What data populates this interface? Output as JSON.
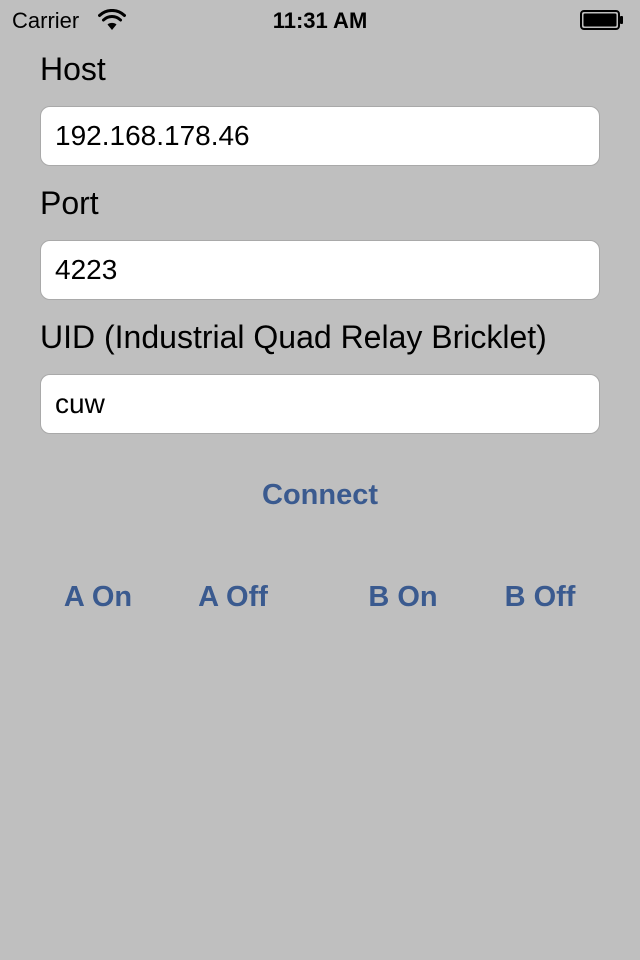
{
  "status_bar": {
    "carrier": "Carrier",
    "time": "11:31 AM",
    "wifi_icon": "wifi-icon",
    "battery_icon": "battery-icon"
  },
  "form": {
    "host_label": "Host",
    "host_value": "192.168.178.46",
    "port_label": "Port",
    "port_value": "4223",
    "uid_label": "UID (Industrial Quad Relay Bricklet)",
    "uid_value": "cuw"
  },
  "buttons": {
    "connect": "Connect",
    "a_on": "A On",
    "a_off": "A Off",
    "b_on": "B On",
    "b_off": "B Off"
  },
  "colors": {
    "background": "#bfbfbf",
    "button_text": "#3a5a8f",
    "field_background": "#ffffff"
  }
}
